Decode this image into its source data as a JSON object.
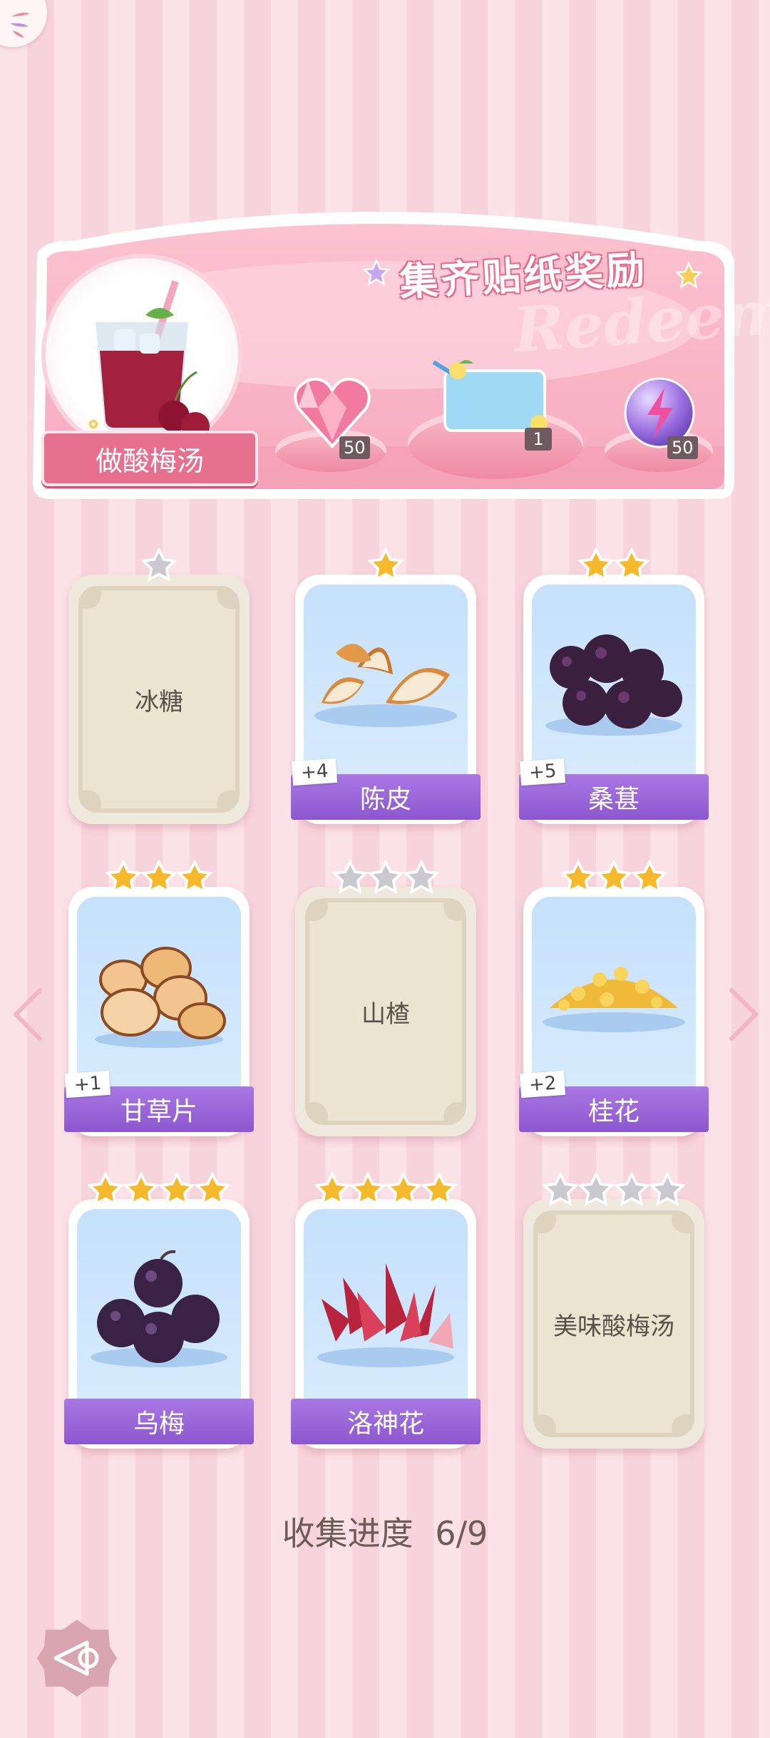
{
  "banner": {
    "title": "集齐贴纸奖励",
    "watermark": "Redeem",
    "recipe_label": "做酸梅汤",
    "rewards": [
      {
        "icon": "pink-heart-gem-icon",
        "count": "50"
      },
      {
        "icon": "blue-sticker-card-icon",
        "count": "1"
      },
      {
        "icon": "purple-energy-orb-icon",
        "count": "50"
      }
    ]
  },
  "cards": [
    {
      "name": "冰糖",
      "stars": 1,
      "collected": false,
      "plus": "",
      "icon": "rock-sugar-icon"
    },
    {
      "name": "陈皮",
      "stars": 1,
      "collected": true,
      "plus": "+4",
      "icon": "tangerine-peel-icon"
    },
    {
      "name": "桑葚",
      "stars": 2,
      "collected": true,
      "plus": "+5",
      "icon": "mulberry-icon"
    },
    {
      "name": "甘草片",
      "stars": 3,
      "collected": true,
      "plus": "+1",
      "icon": "licorice-slices-icon"
    },
    {
      "name": "山楂",
      "stars": 3,
      "collected": false,
      "plus": "",
      "icon": "hawthorn-icon"
    },
    {
      "name": "桂花",
      "stars": 3,
      "collected": true,
      "plus": "+2",
      "icon": "osmanthus-icon"
    },
    {
      "name": "乌梅",
      "stars": 4,
      "collected": true,
      "plus": "",
      "icon": "dark-plum-icon"
    },
    {
      "name": "洛神花",
      "stars": 4,
      "collected": true,
      "plus": "",
      "icon": "roselle-icon"
    },
    {
      "name": "美味酸梅汤",
      "stars": 4,
      "collected": false,
      "plus": "",
      "icon": "plum-soup-icon"
    }
  ],
  "progress": {
    "label": "收集进度",
    "value": "6/9"
  },
  "colors": {
    "accent_pink": "#e7708f",
    "label_purple": "#9a66d9",
    "star_gold": "#f6b92c",
    "star_grey": "#c9c9cf"
  }
}
